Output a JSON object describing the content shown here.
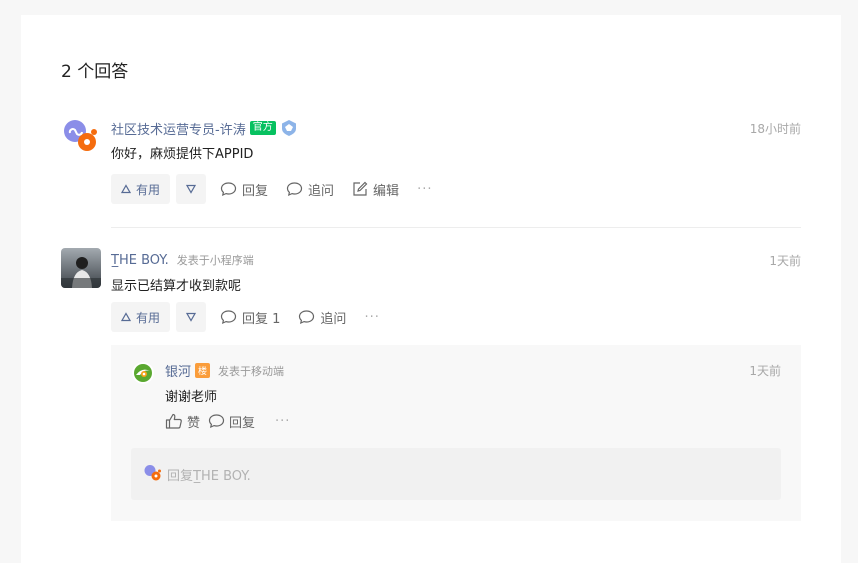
{
  "header": {
    "count_title": "2 个回答"
  },
  "answers": [
    {
      "author": "社区技术运营专员-许涛",
      "badge": "官方",
      "time": "18小时前",
      "content": "你好，麻烦提供下APPID",
      "actions": {
        "useful": "有用",
        "reply": "回复",
        "follow_up": "追问",
        "edit": "编辑",
        "more": "···"
      }
    },
    {
      "author": "T̲HE BOY.",
      "posted_from": "发表于小程序端",
      "time": "1天前",
      "content": "显示已结算才收到款呢",
      "actions": {
        "useful": "有用",
        "reply": "回复 1",
        "follow_up": "追问",
        "more": "···"
      },
      "replies": [
        {
          "author": "银河",
          "badge": "楼",
          "posted_from": "发表于移动端",
          "time": "1天前",
          "content": "谢谢老师",
          "actions": {
            "like": "赞",
            "reply": "回复",
            "more": "···"
          }
        }
      ],
      "reply_placeholder": "回复T̲HE BOY."
    }
  ],
  "colors": {
    "link": "#576b95",
    "official_green": "#07c160",
    "floor_orange": "#fa9d3b"
  },
  "icons": [
    "mini-program-logo-icon",
    "level-shield-icon",
    "triangle-up-icon",
    "triangle-down-icon",
    "comment-bubble-icon",
    "edit-icon",
    "thumbs-up-icon",
    "galaxy-logo-icon"
  ]
}
